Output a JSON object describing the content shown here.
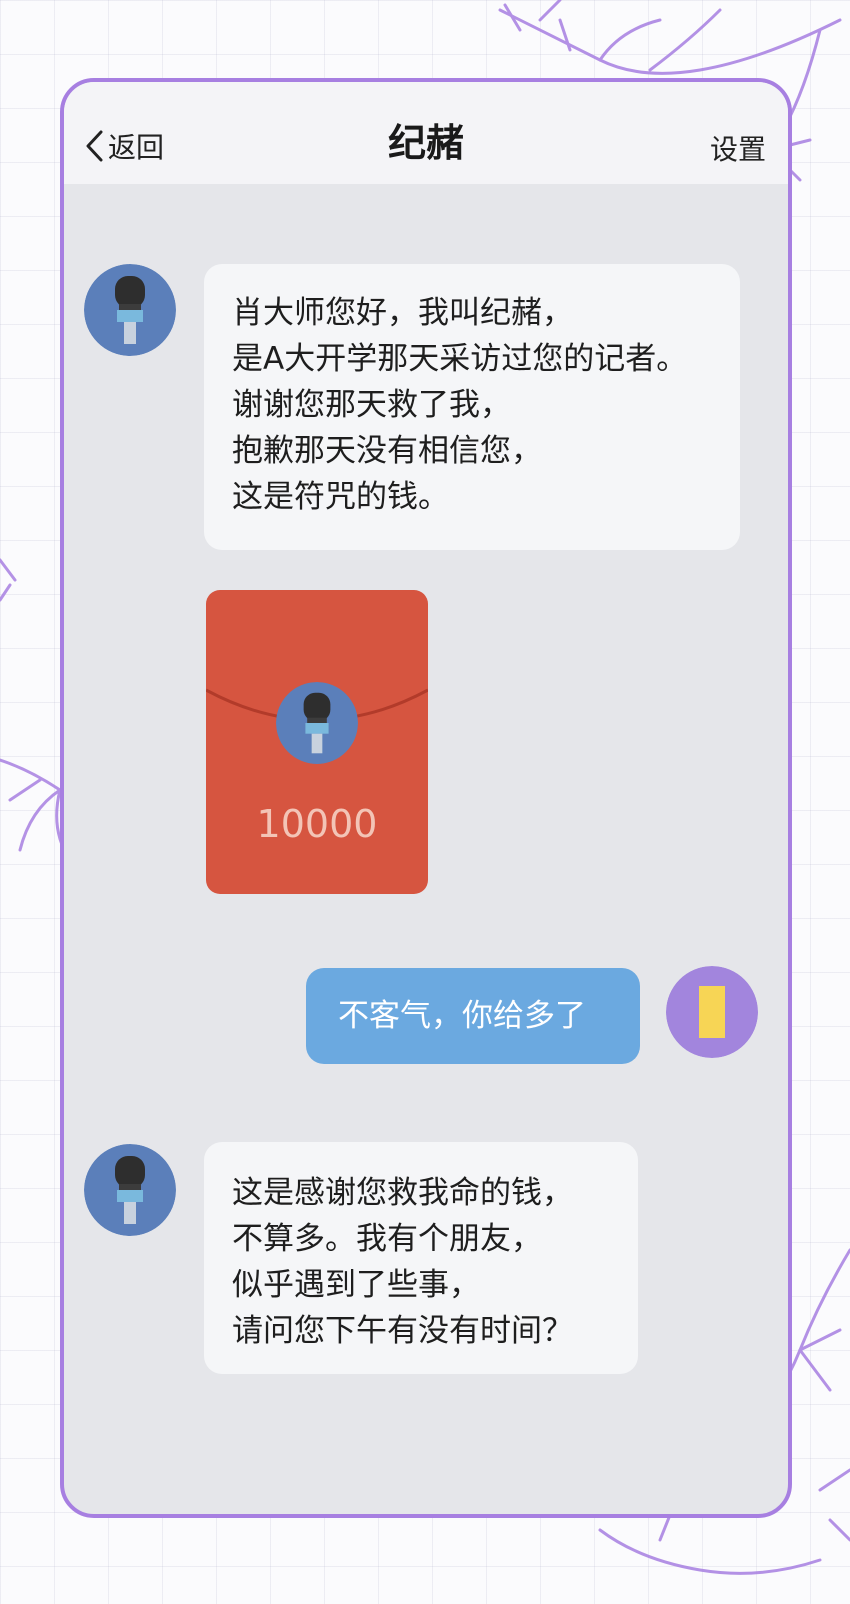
{
  "header": {
    "back_label": "返回",
    "title": "纪赭",
    "settings_label": "设置"
  },
  "messages": [
    {
      "direction": "incoming",
      "sender_avatar": "reporter-avatar",
      "lines": [
        "肖大师您好，我叫纪赭，",
        "是A大开学那天采访过您的记者。",
        "谢谢您那天救了我，",
        "抱歉那天没有相信您，",
        "这是符咒的钱。"
      ]
    },
    {
      "direction": "incoming",
      "type": "red-packet",
      "sender_avatar": "reporter-avatar",
      "amount": "10000"
    },
    {
      "direction": "outgoing",
      "sender_avatar": "master-avatar",
      "lines": [
        "不客气，你给多了"
      ]
    },
    {
      "direction": "incoming",
      "sender_avatar": "reporter-avatar",
      "lines": [
        "这是感谢您救我命的钱，",
        "不算多。我有个朋友，",
        "似乎遇到了些事，",
        "请问您下午有没有时间？"
      ]
    }
  ],
  "colors": {
    "frame_border": "#a77fe1",
    "chat_background": "#e5e6ea",
    "header_background": "#f4f4f7",
    "incoming_bubble": "#f5f6f8",
    "outgoing_bubble": "#6ba9e0",
    "red_packet": "#d65540",
    "reporter_avatar": "#5b7fba",
    "master_avatar": "#a285dd"
  }
}
